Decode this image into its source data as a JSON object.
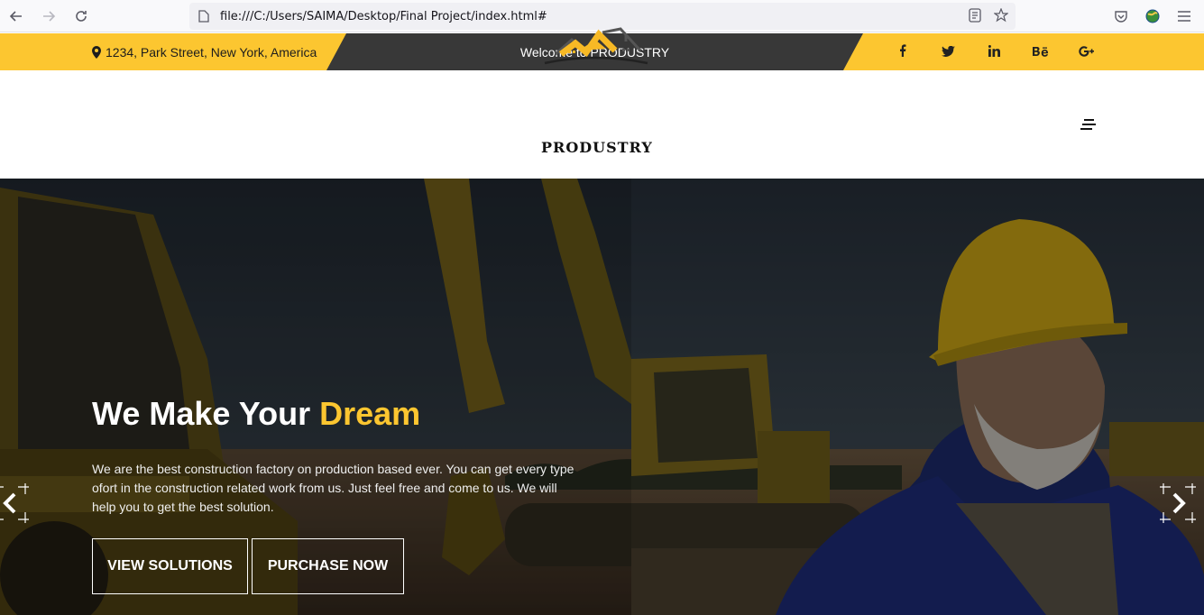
{
  "browser": {
    "url": "file:///C:/Users/SAIMA/Desktop/Final Project/index.html#"
  },
  "topbar": {
    "address": "1234, Park Street, New York, America",
    "welcome": "Welcome to PRODUSTRY",
    "socials": [
      {
        "icon": "facebook-icon",
        "label": "f"
      },
      {
        "icon": "twitter-icon",
        "label": "t"
      },
      {
        "icon": "linkedin-icon",
        "label": "in"
      },
      {
        "icon": "behance-icon",
        "label": "Bē"
      },
      {
        "icon": "google-plus-icon",
        "label": "G+"
      }
    ]
  },
  "header": {
    "logo_text": "PRODUSTRY"
  },
  "hero": {
    "title_main": "We Make Your ",
    "title_accent": "Dream",
    "text": "We are the best construction factory on production based ever. You can get every type ofort in the construction related work from us. Just feel free and come to us. We will help you to get the best solution.",
    "btn_view": "VIEW SOLUTIONS",
    "btn_purchase": "PURCHASE NOW"
  },
  "colors": {
    "accent": "#fcc630",
    "dark": "#383838"
  }
}
